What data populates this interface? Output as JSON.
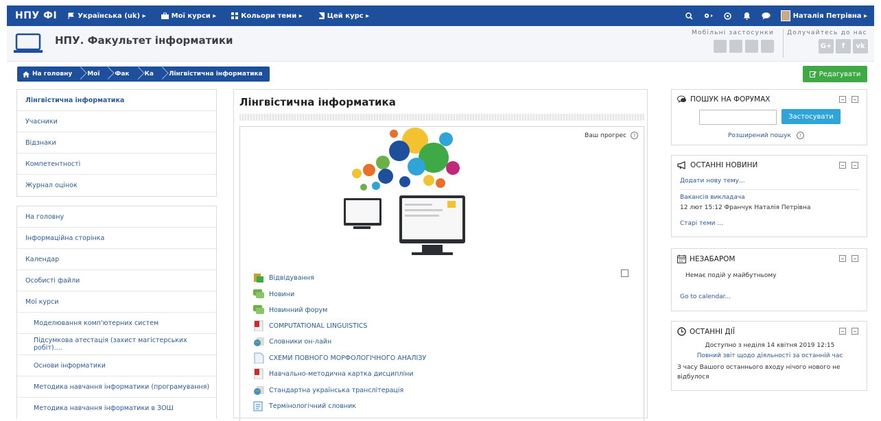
{
  "navbar": {
    "brand": "НПУ ФІ",
    "items": [
      {
        "label": "Українська (uk) ▸",
        "icon": "flag-icon"
      },
      {
        "label": "Мої курси ▸",
        "icon": "briefcase-icon"
      },
      {
        "label": "Кольори теми ▸",
        "icon": "grid-icon"
      },
      {
        "label": "Цей курс ▸",
        "icon": "book-icon"
      }
    ],
    "user_name": "Наталія Петрівна ▸"
  },
  "header": {
    "site_title": "НПУ. Факультет інформатики",
    "mobile_label": "Мобільні застосунки",
    "join_label": "Долучайтесь до нас",
    "social": [
      "G+",
      "f",
      "vk"
    ]
  },
  "breadcrumb": {
    "items": [
      "На головну",
      "Мої",
      "Фак",
      "Ка",
      "Лінгвістична інформатика"
    ]
  },
  "edit_button": "Редагувати",
  "left_course_nav": [
    "Лінгвістична інформатика",
    "Учасники",
    "Відзнаки",
    "Компетентності",
    "Журнал оцінок"
  ],
  "left_main_nav": [
    {
      "label": "На головну",
      "sub": false
    },
    {
      "label": "Інформаційна сторінка",
      "sub": false
    },
    {
      "label": "Календар",
      "sub": false
    },
    {
      "label": "Особисті файли",
      "sub": false
    },
    {
      "label": "Мої курси",
      "sub": false
    },
    {
      "label": "Моделювання комп'ютерних систем",
      "sub": true
    },
    {
      "label": "Підсумкова атестація (захист магістерських робіт)....",
      "sub": true
    },
    {
      "label": "Основи інформатики",
      "sub": true
    },
    {
      "label": "Методика навчання інформатики (програмування)",
      "sub": true
    },
    {
      "label": "Методика навчання інформатики в ЗОШ",
      "sub": true
    }
  ],
  "course": {
    "title": "Лінгвістична інформатика",
    "progress_label": "Ваш прогрес",
    "activities": [
      {
        "label": "Відвідування",
        "icon": "attendance-icon",
        "color": "#c8a02c"
      },
      {
        "label": "Новини",
        "icon": "forum-icon",
        "color": "#6cb04a"
      },
      {
        "label": "Новинний форум",
        "icon": "forum-icon",
        "color": "#6cb04a"
      },
      {
        "label": "COMPUTATIONAL LINGUISTICS",
        "icon": "pdf-icon",
        "color": "#cc2a2a"
      },
      {
        "label": "Словники он-лайн",
        "icon": "url-icon",
        "color": "#4a8cc4"
      },
      {
        "label": "СХЕМИ ПОВНОГО МОРФОЛОГІЧНОГО АНАЛІЗУ",
        "icon": "page-icon",
        "color": "#7aa6d6"
      },
      {
        "label": "Навчально-методична картка дисципліни",
        "icon": "pdf-icon",
        "color": "#cc2a2a"
      },
      {
        "label": "Стандартна українська транслітерація",
        "icon": "url-icon",
        "color": "#4a8cc4"
      },
      {
        "label": "Термінологічний словник",
        "icon": "glossary-icon",
        "color": "#4a8cc4"
      }
    ]
  },
  "forum_search": {
    "title": "ПОШУК НА ФОРУМАХ",
    "button": "Застосувати",
    "advanced": "Розширений пошук"
  },
  "news": {
    "title": "ОСТАННІ НОВИНИ",
    "add": "Додати нову тему...",
    "item_title": "Вакансія викладача",
    "item_meta": "12 лют 15:12 Франчук Наталія Петрівна",
    "older": "Старі теми ..."
  },
  "upcoming": {
    "title": "НЕЗАБАРОМ",
    "empty": "Немає подій у майбутньому",
    "link": "Go to calendar..."
  },
  "recent": {
    "title": "ОСТАННІ ДІЇ",
    "since": "Доступно з неділя 14 квітня 2019 12:15",
    "report": "Повний звіт щодо діяльності за останній час",
    "nothing": "З часу Вашого останнього входу нічого нового не відбулося"
  },
  "colors": {
    "navbar": "#1d4f9c",
    "edit": "#3ea945",
    "apply": "#2fa4d8"
  }
}
